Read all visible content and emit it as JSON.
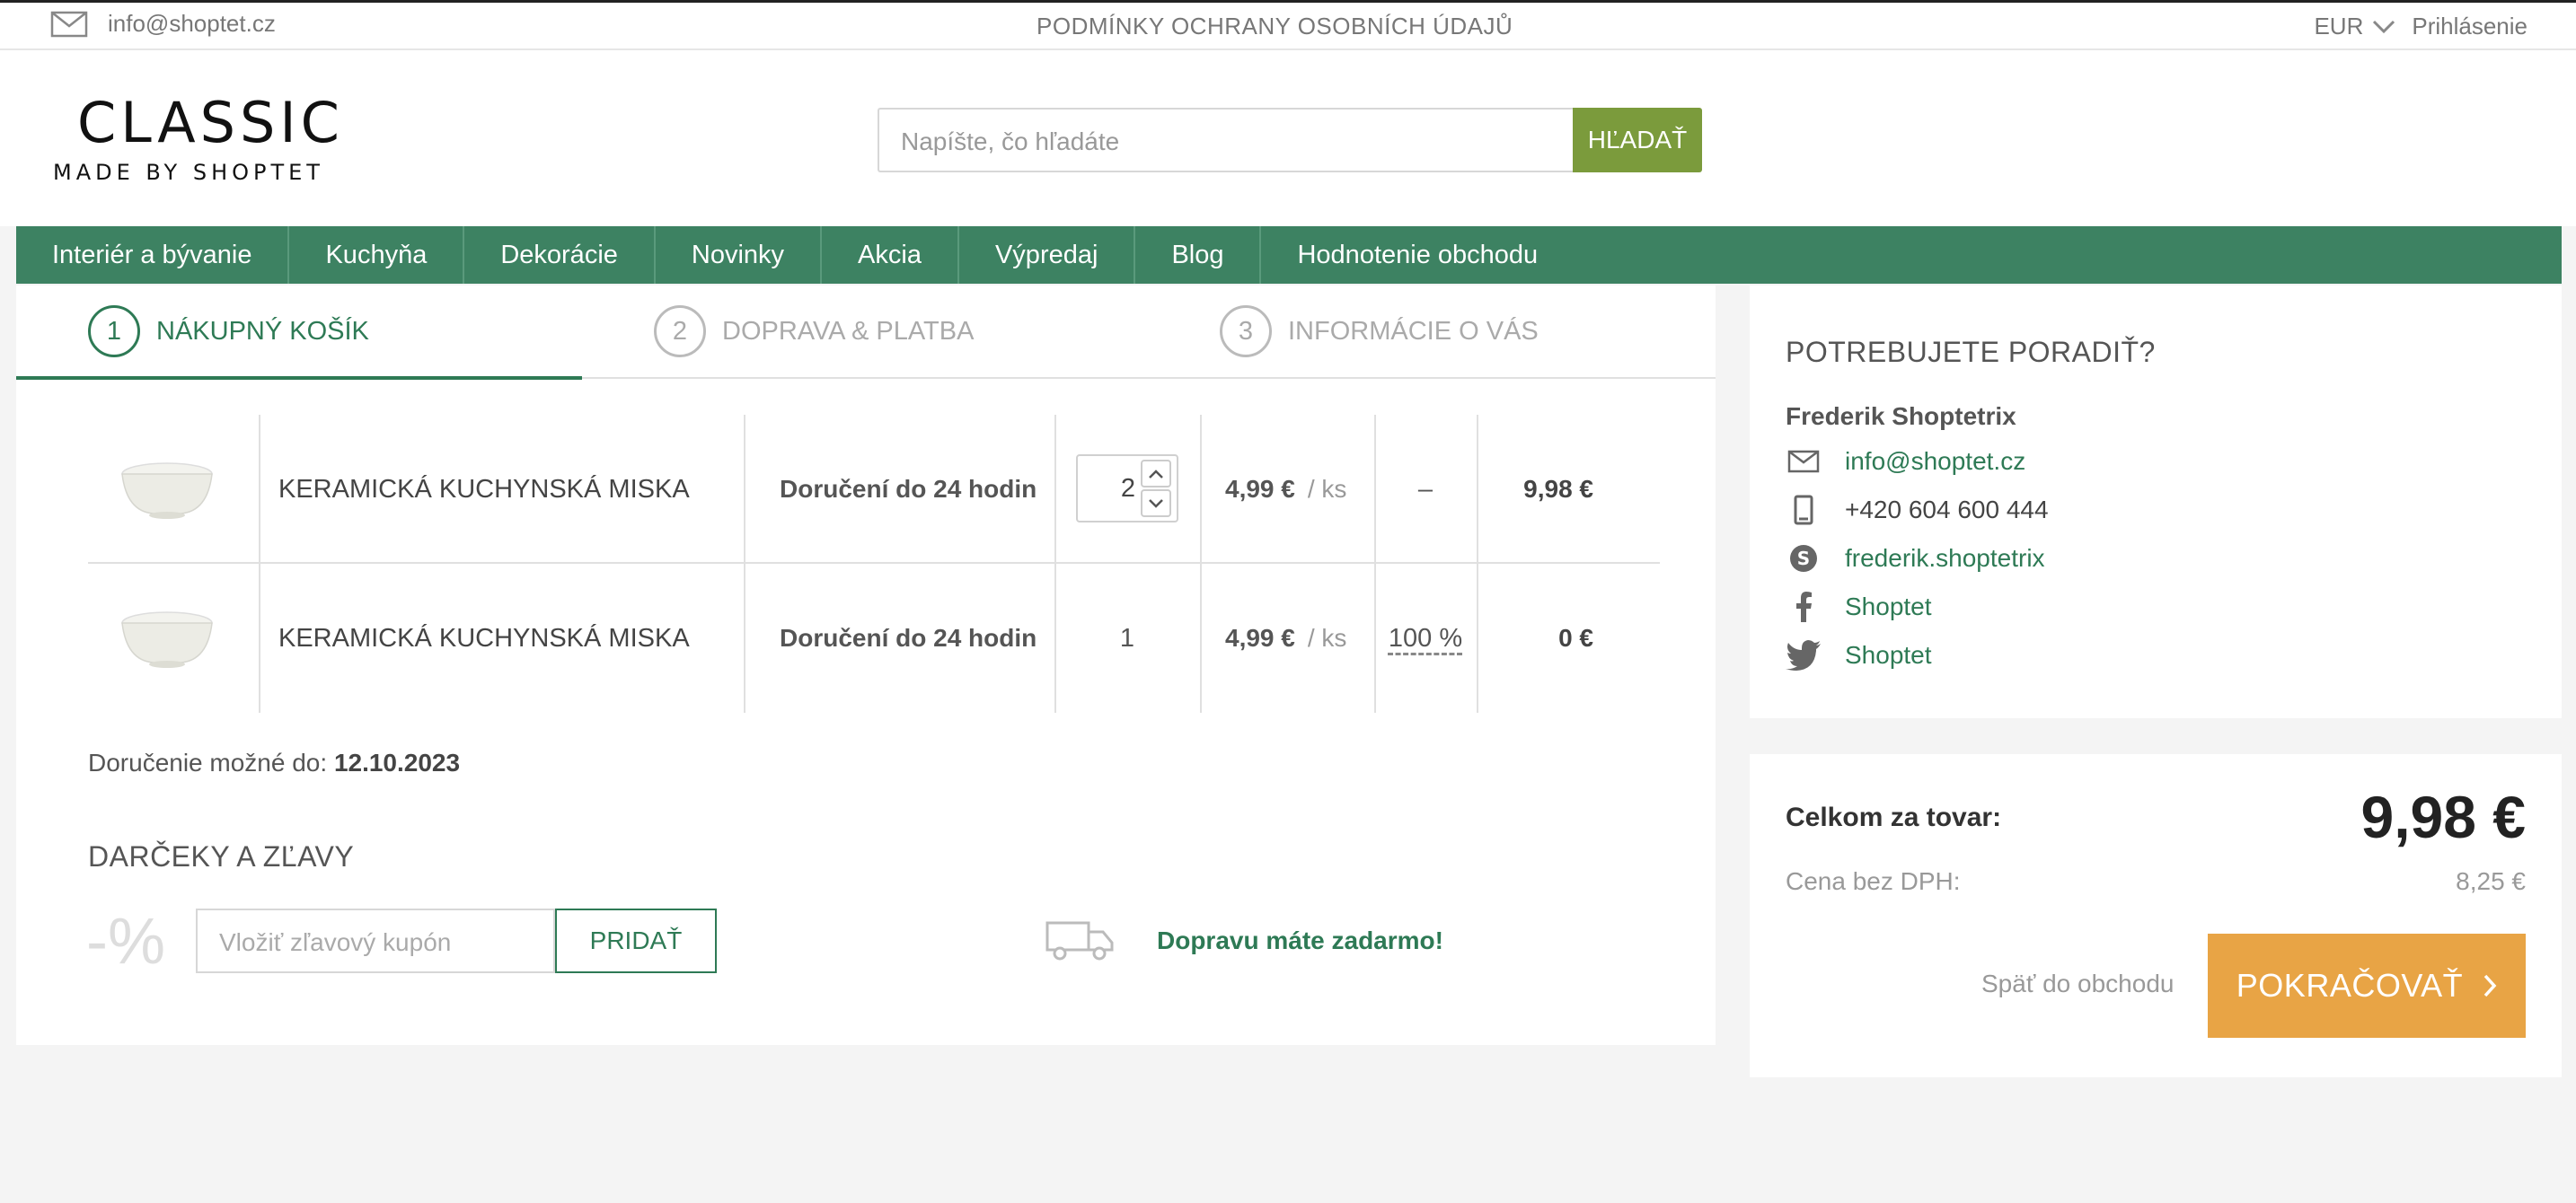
{
  "topbar": {
    "email": "info@shoptet.cz",
    "privacy_link": "PODMÍNKY OCHRANY OSOBNÍCH ÚDAJŮ",
    "currency": "EUR",
    "login": "Prihlásenie"
  },
  "header": {
    "logo_main": "CLASSIC",
    "logo_sub": "MADE BY SHOPTET",
    "search_placeholder": "Napíšte, čo hľadáte",
    "search_button": "HĽADAŤ"
  },
  "nav": {
    "items": [
      {
        "label": "Interiér a bývanie"
      },
      {
        "label": "Kuchyňa"
      },
      {
        "label": "Dekorácie"
      },
      {
        "label": "Novinky"
      },
      {
        "label": "Akcia"
      },
      {
        "label": "Výpredaj"
      },
      {
        "label": "Blog"
      },
      {
        "label": "Hodnotenie obchodu"
      }
    ]
  },
  "steps": [
    {
      "num": "1",
      "label": "NÁKUPNÝ KOŠÍK"
    },
    {
      "num": "2",
      "label": "DOPRAVA & PLATBA"
    },
    {
      "num": "3",
      "label": "INFORMÁCIE O VÁS"
    }
  ],
  "cart": {
    "rows": [
      {
        "name": "KERAMICKÁ KUCHYNSKÁ MISKA",
        "availability": "Doručení do 24 hodin",
        "quantity": "2",
        "price": "4,99 €",
        "unit": "/ ks",
        "discount": "–",
        "total": "9,98 €"
      },
      {
        "name": "KERAMICKÁ KUCHYNSKÁ MISKA",
        "availability": "Doručení do 24 hodin",
        "quantity": "1",
        "price": "4,99 €",
        "unit": "/ ks",
        "discount": "100 %",
        "total": "0 €"
      }
    ],
    "delivery_label": "Doručenie možné do:",
    "delivery_date": "12.10.2023"
  },
  "gifts": {
    "title": "DARČEKY A ZĽAVY",
    "percent_symbol": "-%",
    "coupon_placeholder": "Vložiť zľavový kupón",
    "coupon_button": "PRIDAŤ",
    "free_shipping": "Dopravu máte zadarmo!"
  },
  "advice": {
    "title": "POTREBUJETE PORADIŤ?",
    "name": "Frederik Shoptetrix",
    "email": "info@shoptet.cz",
    "phone": "+420 604 600 444",
    "skype": "frederik.shoptetrix",
    "facebook": "Shoptet",
    "twitter": "Shoptet"
  },
  "summary": {
    "total_label": "Celkom za tovar:",
    "total_value": "9,98 €",
    "net_label": "Cena bez DPH:",
    "net_value": "8,25 €",
    "back_link": "Späť do obchodu",
    "continue_button": "POKRAČOVAŤ"
  },
  "colors": {
    "brand_green": "#3d8262",
    "search_green": "#7b9b3c",
    "accent_orange": "#e8a445"
  }
}
